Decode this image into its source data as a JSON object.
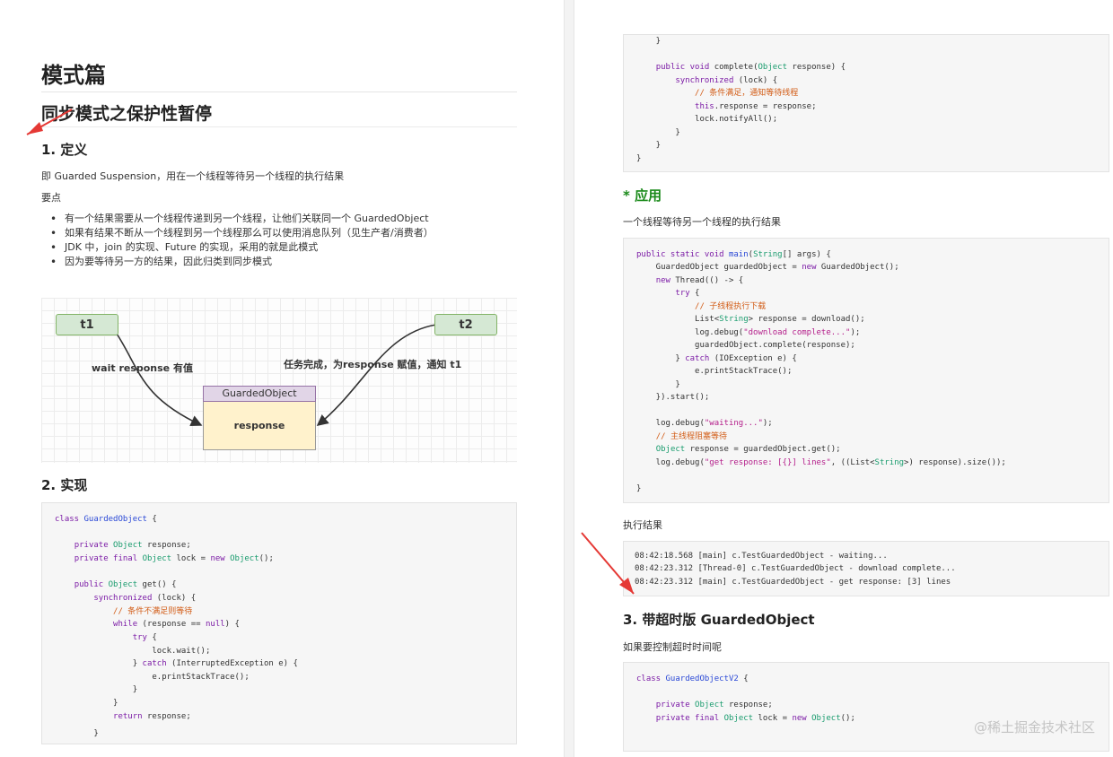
{
  "left": {
    "title": "模式篇",
    "subtitle": "同步模式之保护性暂停",
    "section1_title": "1. 定义",
    "definition": "即 Guarded Suspension，用在一个线程等待另一个线程的执行结果",
    "key_points_label": "要点",
    "bullets": [
      "有一个结果需要从一个线程传递到另一个线程，让他们关联同一个 GuardedObject",
      "如果有结果不断从一个线程到另一个线程那么可以使用消息队列（见生产者/消费者）",
      "JDK 中，join 的实现、Future 的实现，采用的就是此模式",
      "因为要等待另一方的结果，因此归类到同步模式"
    ],
    "diagram": {
      "t1": "t1",
      "t2": "t2",
      "object_title": "GuardedObject",
      "object_field": "response",
      "label_left": "wait response 有值",
      "label_right": "任务完成，为response 赋值，通知 t1"
    },
    "section2_title": "2. 实现"
  },
  "right": {
    "section_apply": "* 应用",
    "apply_desc": "一个线程等待另一个线程的执行结果",
    "result_label": "执行结果",
    "log_lines": [
      "08:42:18.568 [main] c.TestGuardedObject - waiting...",
      "08:42:23.312 [Thread-0] c.TestGuardedObject - download complete...",
      "08:42:23.312 [main] c.TestGuardedObject - get response: [3] lines"
    ],
    "section3_title": "3. 带超时版 GuardedObject",
    "section3_desc": "如果要控制超时时间呢"
  },
  "watermark": "@稀土掘金技术社区",
  "code_colors": {
    "keyword": "#7c1ca6",
    "type": "#1a9c6e",
    "class": "#2a48d6",
    "comment": "#d25c16",
    "string": "#b41d8a"
  },
  "arrow_color": "#e53935"
}
